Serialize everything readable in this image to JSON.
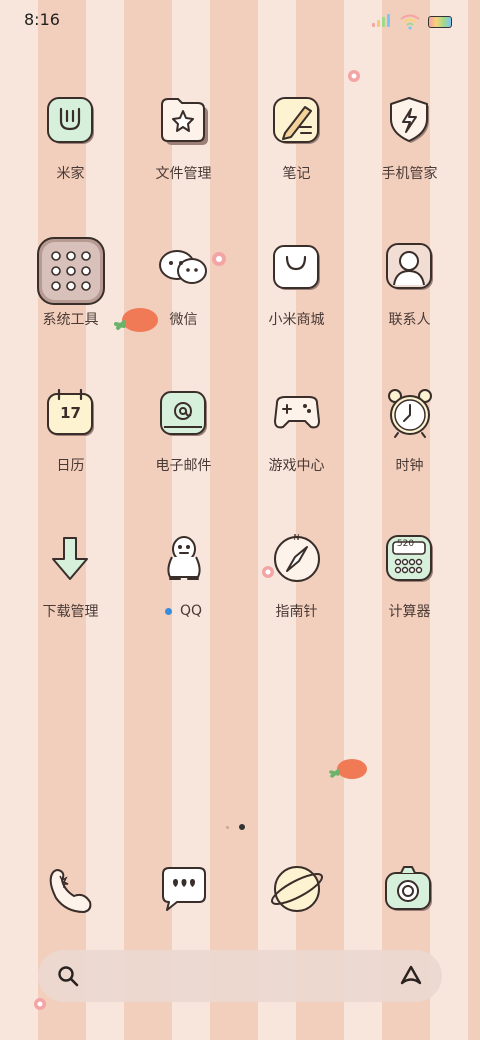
{
  "status_bar": {
    "time": "8:16"
  },
  "apps": [
    {
      "label": "米家"
    },
    {
      "label": "文件管理"
    },
    {
      "label": "笔记"
    },
    {
      "label": "手机管家"
    },
    {
      "label": "系统工具"
    },
    {
      "label": "微信"
    },
    {
      "label": "小米商城"
    },
    {
      "label": "联系人"
    },
    {
      "label": "日历",
      "badge": "17"
    },
    {
      "label": "电子邮件"
    },
    {
      "label": "游戏中心"
    },
    {
      "label": "时钟"
    },
    {
      "label": "下载管理"
    },
    {
      "label": "QQ"
    },
    {
      "label": "指南针",
      "compass_letter": "N"
    },
    {
      "label": "计算器",
      "display": "520"
    }
  ],
  "page_indicator": {
    "pages": 2,
    "current": 2
  },
  "dock": [
    {
      "icon": "phone-icon"
    },
    {
      "icon": "messages-icon"
    },
    {
      "icon": "browser-icon"
    },
    {
      "icon": "camera-icon"
    }
  ],
  "colors": {
    "mint": "#d6f0dc",
    "cream": "#fdf3d0",
    "outline": "#3a2e2a",
    "stripe_light": "#f8e6dc",
    "stripe_dark": "#f2cfbd"
  }
}
